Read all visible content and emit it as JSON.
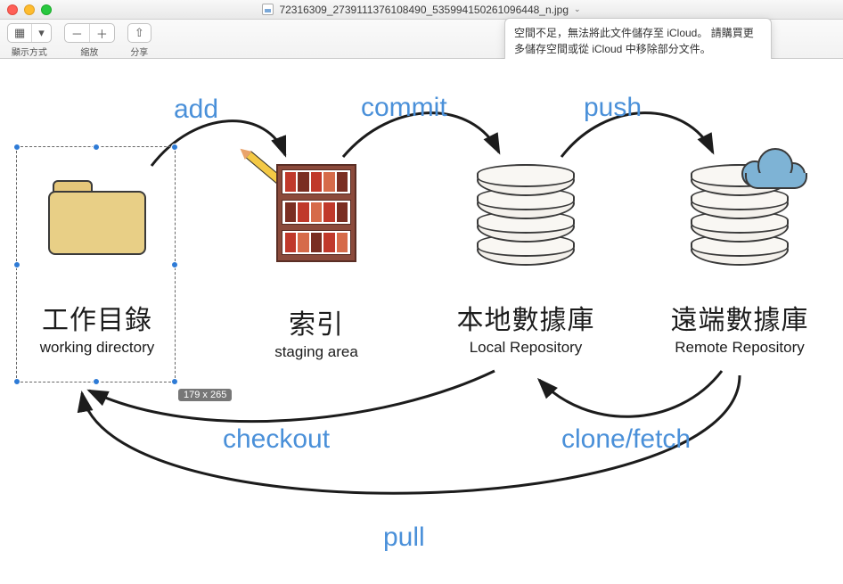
{
  "window": {
    "filename": "72316309_2739111376108490_535994150261096448_n.jpg",
    "dropdown_glyph": "⌄"
  },
  "toolbar": {
    "view": {
      "label": "顯示方式",
      "icon1": "▦",
      "icon2": "▾"
    },
    "zoom": {
      "label": "縮放",
      "in": "＋",
      "out": "－"
    },
    "share": {
      "label": "分享",
      "icon": "⇧"
    }
  },
  "notification": {
    "text": "空間不足，無法將此文件儲存至 iCloud。 請購買更多儲存空間或從 iCloud 中移除部分文件。"
  },
  "nodes": {
    "wd": {
      "zh": "工作目錄",
      "en": "working directory"
    },
    "idx": {
      "zh": "索引",
      "en": "staging area"
    },
    "loc": {
      "zh": "本地數據庫",
      "en": "Local Repository"
    },
    "rem": {
      "zh": "遠端數據庫",
      "en": "Remote Repository"
    }
  },
  "ops": {
    "add": "add",
    "commit": "commit",
    "push": "push",
    "checkout": "checkout",
    "clone": "clone/fetch",
    "pull": "pull"
  },
  "selection": {
    "size_label": "179 x 265"
  }
}
